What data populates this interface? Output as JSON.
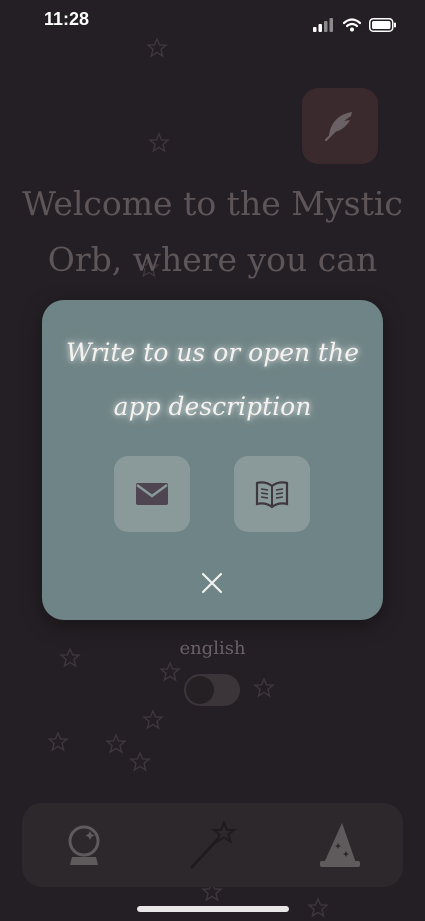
{
  "status_bar": {
    "time": "11:28"
  },
  "welcome_text": "Welcome to the Mystic Orb, where you can get predictions",
  "language": {
    "label": "english"
  },
  "modal": {
    "title": "Write to us or open the app description"
  },
  "icons": {
    "feather": "feather-icon",
    "mail": "mail-icon",
    "book": "book-icon",
    "close": "close-icon",
    "tab_orb": "crystal-ball-icon",
    "tab_wand": "magic-wand-icon",
    "tab_wizard": "wizard-hat-icon"
  },
  "colors": {
    "background": "#241f24",
    "modal": "#6f8486",
    "modal_button": "#8a9a9b"
  }
}
